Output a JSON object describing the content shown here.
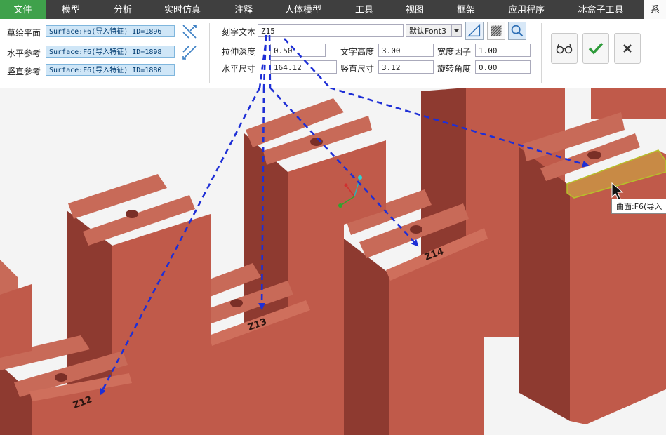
{
  "menu": {
    "file": "文件",
    "items": [
      "模型",
      "分析",
      "实时仿真",
      "注释",
      "人体模型",
      "工具",
      "视图",
      "框架",
      "应用程序",
      "冰盒子工具"
    ],
    "cut_tab": "系"
  },
  "ribbon": {
    "sketch_plane_label": "草绘平面",
    "sketch_plane_value": "Surface:F6(导入特征) ID=1896",
    "horizontal_ref_label": "水平参考",
    "horizontal_ref_value": "Surface:F6(导入特征) ID=1898",
    "vertical_ref_label": "竖直参考",
    "vertical_ref_value": "Surface:F6(导入特征) ID=1880",
    "engrave_text_label": "刻字文本",
    "engrave_text_value": "Z15",
    "font_value": "默认Font3",
    "extrude_depth_label": "拉伸深度",
    "extrude_depth_value": "0.50",
    "text_height_label": "文字高度",
    "text_height_value": "3.00",
    "width_factor_label": "宽度因子",
    "width_factor_value": "1.00",
    "horizontal_size_label": "水平尺寸",
    "horizontal_size_value": "164.12",
    "vertical_size_label": "竖直尺寸",
    "vertical_size_value": "3.12",
    "rotation_label": "旋转角度",
    "rotation_value": "0.00"
  },
  "viewport": {
    "engravings": [
      "Z12",
      "Z13",
      "Z14"
    ],
    "tooltip": "曲面:F6(导入"
  },
  "icons": [
    "swap-arrows-icon",
    "font-dropdown-icon",
    "plane-icon",
    "hatch-icon",
    "zoom-pick-icon",
    "preview-glasses-icon",
    "check-icon",
    "close-icon",
    "coordinate-axes-icon",
    "mouse-cursor-icon"
  ],
  "colors": {
    "menu_bg": "#3f3f3f",
    "file_tab": "#3fa14b",
    "part": "#c05a4a",
    "part_dark": "#8e3a30",
    "highlight": "#c88a45",
    "arrow": "#1e2fd6"
  }
}
